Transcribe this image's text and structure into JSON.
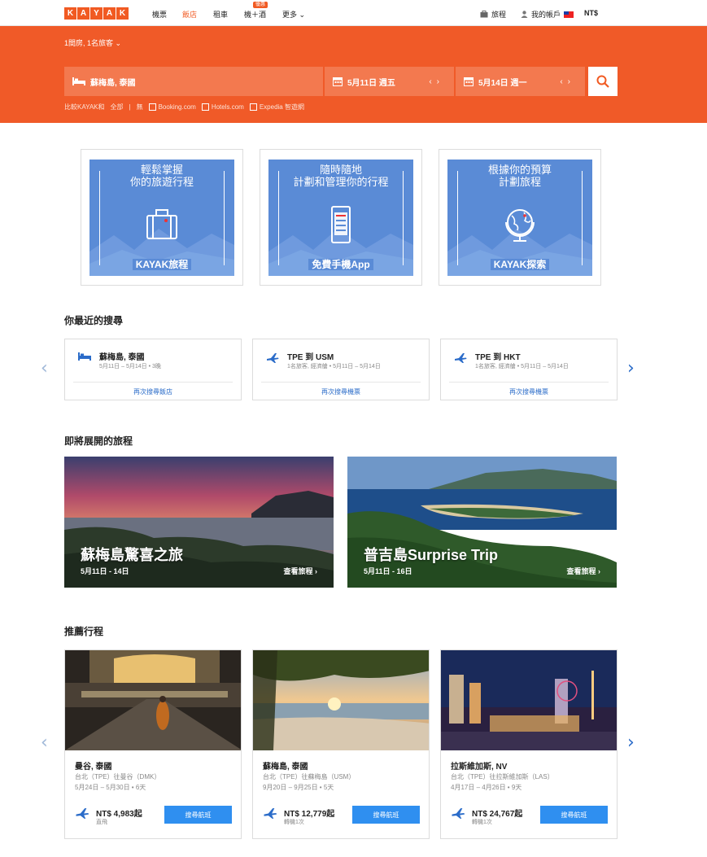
{
  "topnav": {
    "logo_letters": [
      "K",
      "A",
      "Y",
      "A",
      "K"
    ],
    "items": [
      "機票",
      "飯店",
      "租車",
      "機＋酒",
      "更多"
    ],
    "deal_badge": "優惠",
    "trips": "旅程",
    "account": "我的帳戶",
    "currency": "NT$"
  },
  "search": {
    "guests": "1間房, 1名旅客",
    "destination": "蘇梅島, 泰國",
    "checkin": "5月11日 週五",
    "checkout": "5月14日 週一",
    "compare_label": "比較KAYAK和",
    "compare_all": "全部",
    "compare_sep": "|",
    "compare_none": "無",
    "providers": [
      "Booking.com",
      "Hotels.com",
      "Expedia 智遊網"
    ]
  },
  "promos": [
    {
      "line1": "輕鬆掌握",
      "line2": "你的旅遊行程",
      "foot": "KAYAK旅程",
      "icon": "suitcase-icon"
    },
    {
      "line1": "隨時隨地",
      "line2": "計劃和管理你的行程",
      "foot": "免費手機App",
      "icon": "phone-icon"
    },
    {
      "line1": "根據你的預算",
      "line2": "計劃旅程",
      "foot": "KAYAK探索",
      "icon": "globe-icon"
    }
  ],
  "recent": {
    "title": "你最近的搜尋",
    "items": [
      {
        "title": "蘇梅島, 泰國",
        "sub": "5月11日 – 5月14日 • 3晚",
        "link": "再次搜尋飯店",
        "icon": "bed-icon"
      },
      {
        "title": "TPE 到 USM",
        "sub": "1名旅客, 經濟艙 • 5月11日 – 5月14日",
        "link": "再次搜尋機票",
        "icon": "plane-icon"
      },
      {
        "title": "TPE 到 HKT",
        "sub": "1名旅客, 經濟艙 • 5月11日 – 5月14日",
        "link": "再次搜尋機票",
        "icon": "plane-icon"
      }
    ]
  },
  "upcoming": {
    "title": "即將展開的旅程",
    "trips": [
      {
        "title": "蘇梅島驚喜之旅",
        "dates": "5月11日 - 14日",
        "link": "查看旅程"
      },
      {
        "title": "普吉島Surprise Trip",
        "dates": "5月11日 - 16日",
        "link": "查看旅程"
      }
    ]
  },
  "recommended": {
    "title": "推薦行程",
    "items": [
      {
        "city": "曼谷, 泰國",
        "route": "台北（TPE）往曼谷（DMK）",
        "dates": "5月24日 – 5月30日 • 6天",
        "price": "NT$ 4,983起",
        "stops": "直飛",
        "button": "搜尋航班"
      },
      {
        "city": "蘇梅島, 泰國",
        "route": "台北（TPE）往蘇梅島（USM）",
        "dates": "9月20日 – 9月25日 • 5天",
        "price": "NT$ 12,779起",
        "stops": "轉機1次",
        "button": "搜尋航班"
      },
      {
        "city": "拉斯維加斯, NV",
        "route": "台北（TPE）往拉斯維加斯（LAS）",
        "dates": "4月17日 – 4月26日 • 9天",
        "price": "NT$ 24,767起",
        "stops": "轉機1次",
        "button": "搜尋航班"
      }
    ]
  },
  "colors": {
    "brand": "#f15a22",
    "promo_blue": "#5a8bd6",
    "link_blue": "#2b6cc9",
    "button_blue": "#2f8ff0"
  }
}
